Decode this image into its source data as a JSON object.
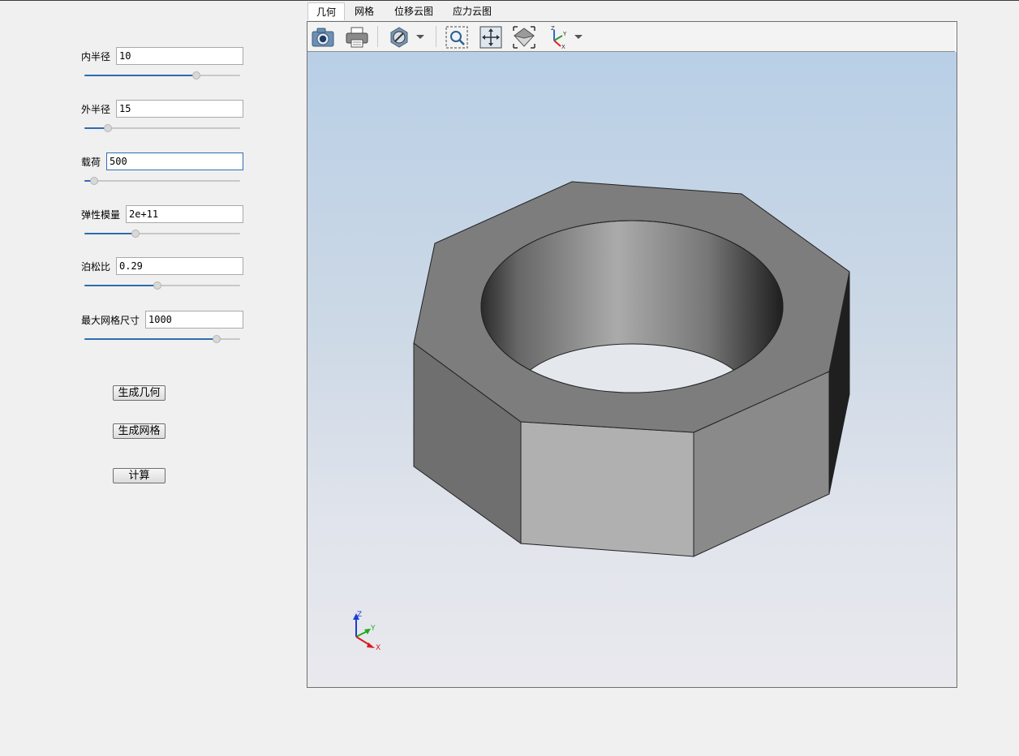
{
  "tabs": [
    {
      "label": "几何",
      "active": true
    },
    {
      "label": "网格",
      "active": false
    },
    {
      "label": "位移云图",
      "active": false
    },
    {
      "label": "应力云图",
      "active": false
    }
  ],
  "params": {
    "inner_radius": {
      "label": "内半径",
      "value": "10",
      "slider_fraction": 0.72
    },
    "outer_radius": {
      "label": "外半径",
      "value": "15",
      "slider_fraction": 0.15
    },
    "load": {
      "label": "载荷",
      "value": "500",
      "slider_fraction": 0.06
    },
    "elastic_modulus": {
      "label": "弹性模量",
      "value": "2e+11",
      "slider_fraction": 0.33
    },
    "poisson_ratio": {
      "label": "泊松比",
      "value": "0.29",
      "slider_fraction": 0.47
    },
    "max_mesh_size": {
      "label": "最大网格尺寸",
      "value": "1000",
      "slider_fraction": 0.85
    }
  },
  "buttons": {
    "generate_geometry": "生成几何",
    "generate_mesh": "生成网格",
    "compute": "计算"
  },
  "toolbar_icons": [
    "camera-icon",
    "print-icon",
    "display-mode-icon",
    "zoom-window-icon",
    "fit-all-icon",
    "view-iso-icon",
    "view-axes-icon"
  ],
  "axis_triad": {
    "x": "X",
    "y": "Y",
    "z": "Z"
  },
  "colors": {
    "accent": "#2c6db0",
    "focus_border": "#2f6db5",
    "viewport_top": "#b9cfe6",
    "viewport_bottom": "#e9e9ee",
    "model_top_face": "#7d7d7d",
    "model_front_face": "#b0b0b0"
  }
}
